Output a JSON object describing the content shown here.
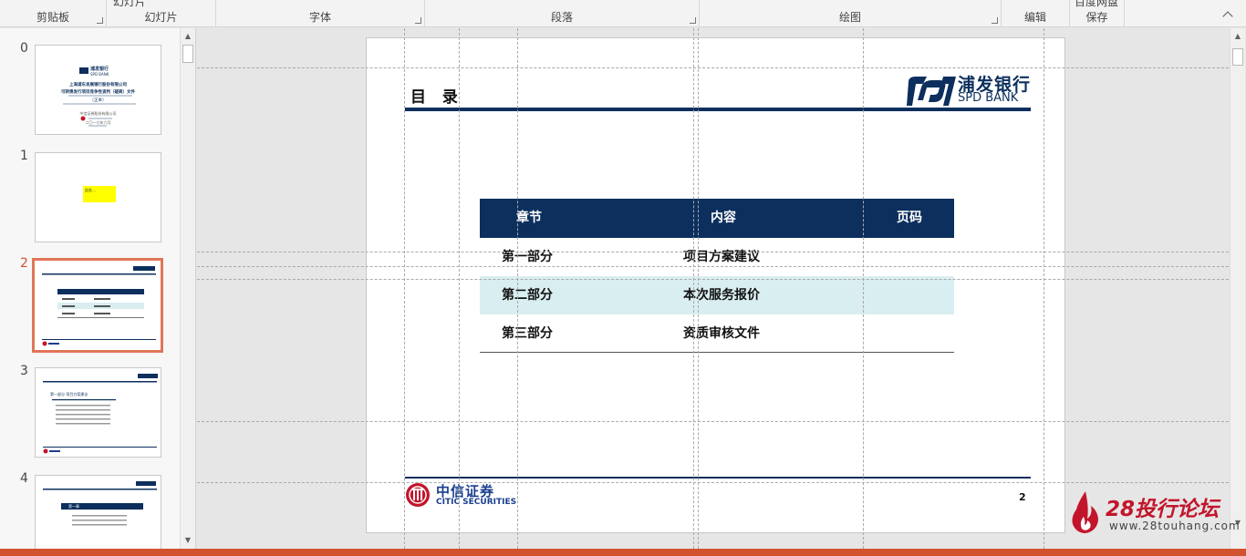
{
  "ribbon": {
    "groups": [
      {
        "label": "剪贴板"
      },
      {
        "label": "幻灯片"
      },
      {
        "label": "字体"
      },
      {
        "label": "段落"
      },
      {
        "label": "绘图"
      },
      {
        "label": "编辑"
      },
      {
        "label": "保存"
      }
    ],
    "cut_top_text": {
      "slides_btn": "幻灯片",
      "save_btn": "百度网盘"
    }
  },
  "thumbnails": [
    {
      "num": "0",
      "lines": [
        "浦发银行",
        "SPD BANK",
        "上海浦东发展银行股份有限公司",
        "可转债发行项目竞争性谈判（磋商）文件",
        "（正本）",
        "中信证券股份有限公司",
        "二〇一七年六月"
      ]
    },
    {
      "num": "1",
      "lines": [
        "此处…"
      ]
    },
    {
      "num": "2",
      "lines": []
    },
    {
      "num": "3",
      "lines": [
        "第一部分 项目方案建议"
      ]
    },
    {
      "num": "4",
      "lines": [
        "第一章"
      ]
    }
  ],
  "slide": {
    "title": "目 录",
    "logo_cn": "浦发银行",
    "logo_en": "SPD BANK",
    "toc_headers": [
      "章节",
      "内容",
      "页码"
    ],
    "toc_rows": [
      {
        "chapter": "第一部分",
        "content": "项目方案建议",
        "page": ""
      },
      {
        "chapter": "第二部分",
        "content": "本次服务报价",
        "page": ""
      },
      {
        "chapter": "第三部分",
        "content": "资质审核文件",
        "page": ""
      }
    ],
    "footer_cn": "中信证券",
    "footer_en": "CITIC SECURITIES",
    "page_number": "2"
  },
  "watermark": {
    "big": "28投行论坛",
    "small": "www.28touhang.com"
  },
  "colors": {
    "navy": "#0c2f5d",
    "shade": "#d9eef0",
    "accent": "#d35230",
    "watermark": "#c2152b"
  }
}
